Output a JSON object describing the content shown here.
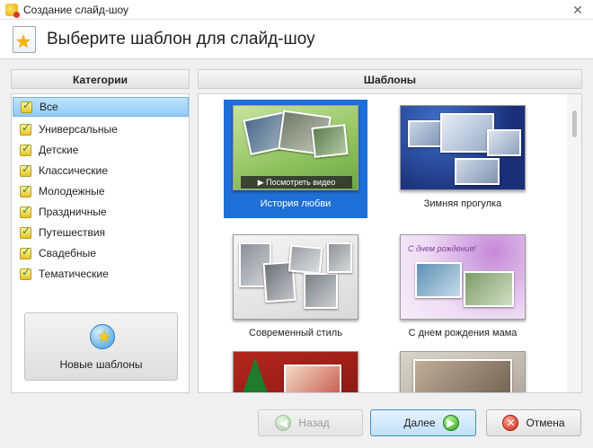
{
  "window": {
    "title": "Создание слайд-шоу",
    "close_glyph": "✕",
    "icon": "app-icon"
  },
  "header": {
    "title": "Выберите шаблон для слайд-шоу",
    "icon": "star-document-icon"
  },
  "categories": {
    "title": "Категории",
    "selected_index": 0,
    "items": [
      {
        "label": "Все"
      },
      {
        "label": "Универсальные"
      },
      {
        "label": "Детские"
      },
      {
        "label": "Классические"
      },
      {
        "label": "Молодежные"
      },
      {
        "label": "Праздничные"
      },
      {
        "label": "Путешествия"
      },
      {
        "label": "Свадебные"
      },
      {
        "label": "Тематические"
      }
    ],
    "new_templates_button": "Новые шаблоны"
  },
  "templates": {
    "title": "Шаблоны",
    "preview_button": "▶ Посмотреть видео",
    "items": [
      {
        "caption": "История любви",
        "selected": true
      },
      {
        "caption": "Зимняя прогулка",
        "selected": false
      },
      {
        "caption": "Современный стиль",
        "selected": false
      },
      {
        "caption": "С днем рождения мама",
        "selected": false,
        "thumb_text": "С днем рождения!"
      },
      {
        "caption": "",
        "selected": false
      },
      {
        "caption": "",
        "selected": false
      }
    ]
  },
  "footer": {
    "back_label": "Назад",
    "back_enabled": false,
    "next_label": "Далее",
    "cancel_label": "Отмена"
  },
  "colors": {
    "selection_blue": "#1e6fd6",
    "accent_green": "#28a51b",
    "cancel_red": "#d52b1b"
  }
}
